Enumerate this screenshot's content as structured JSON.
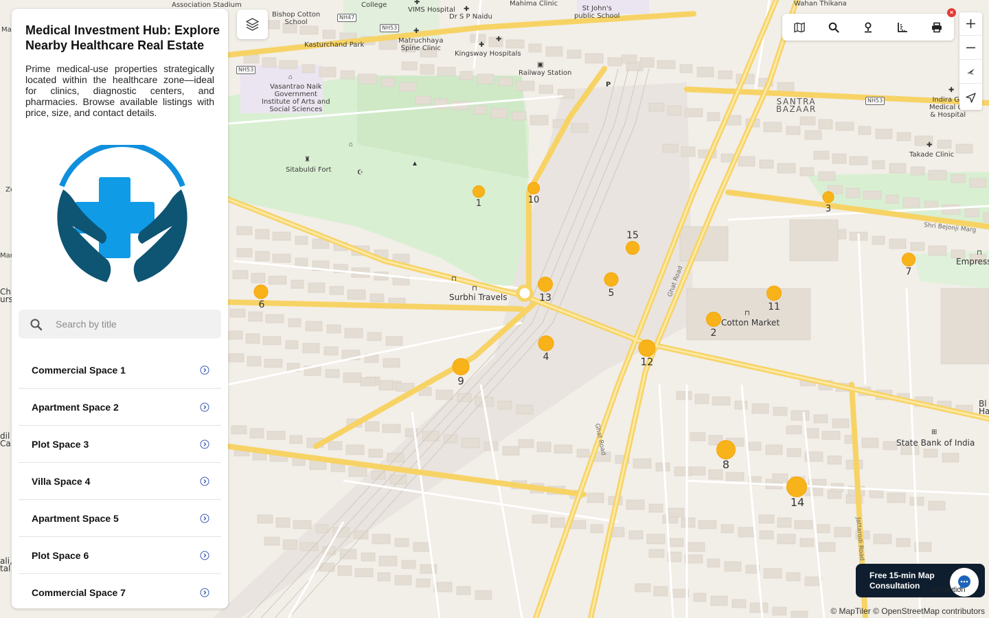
{
  "panel": {
    "title": "Medical Investment Hub: Explore Nearby Healthcare Real Estate",
    "description": "Prime medical-use properties strategically located within the healthcare zone—ideal for clinics, diagnostic centers, and pharmacies. Browse available listings with price, size, and contact details.",
    "logo_icon": "medical-cross-hands-logo",
    "search": {
      "placeholder": "Search by title",
      "value": ""
    },
    "listings": [
      "Commercial Space 1",
      "Apartment Space 2",
      "Plot Space 3",
      "Villa Space 4",
      "Apartment Space 5",
      "Plot Space 6",
      "Commercial Space 7"
    ]
  },
  "map": {
    "markers": [
      "1",
      "2",
      "3",
      "4",
      "5",
      "6",
      "7",
      "8",
      "9",
      "10",
      "11",
      "12",
      "13",
      "14",
      "15"
    ],
    "marker_color": "#f9b31a",
    "places": {
      "association_stadium": "Association Stadium",
      "college": "College",
      "vims": "VIMS Hospital",
      "dr_naidu": "Dr S P Naidu",
      "mahima": "Mahima Clinic",
      "st_johns": "St John's\npublic School",
      "wahan": "Wahan Thikana",
      "bishop": "Bishop Cotton\nSchool",
      "kasturchand": "Kasturchand Park",
      "matruchhaya": "Matruchhaya\nSpine Clinic",
      "kingsway": "Kingsway Hospitals",
      "railway": "Railway Station",
      "vasantrao": "Vasantrao Naik\nGovernment\nInstitute of Arts and\nSocial Sciences",
      "sitabuldi": "Sitabuldi Fort",
      "santra": "SANTRA\nBAZAAR",
      "indira": "Indira Ga\nMedical Co\n& Hospital",
      "takade": "Takade Clinic",
      "empress": "Empress",
      "surbhi": "Surbhi Travels",
      "cotton": "Cotton Market",
      "sbi": "State Bank of India",
      "ghat_road": "Ghat Road",
      "jattarodi": "Jattarodi Road",
      "bejonji": "Shri Bejonji Marg",
      "p": "P",
      "edge_mar": "Mar",
      "edge_ze": "Ze",
      "edge_man": "Man",
      "edge_ch": "Ch\nursi",
      "edge_dil": "dil I\nCa",
      "edge_ali": "ali,\ntal",
      "edge_bl": "Bl\nHa"
    },
    "shields": {
      "nh47": "NH47",
      "nh53a": "NH53",
      "nh53b": "NH53",
      "nh53c": "NH53"
    },
    "attribution": "© MapTiler © OpenStreetMap contributors"
  },
  "controls": {
    "layers_icon": "layers-icon",
    "toolbar_icons": [
      "map-icon",
      "search-icon",
      "person-pin-icon",
      "ruler-icon",
      "print-icon"
    ],
    "zoom_icons": [
      "plus-icon",
      "minus-icon",
      "compass-icon",
      "locate-icon"
    ],
    "close_glyph": "×"
  },
  "consultation": {
    "label": "Free 15-min Map Consultation",
    "attribution_overlay": "Attribution"
  }
}
